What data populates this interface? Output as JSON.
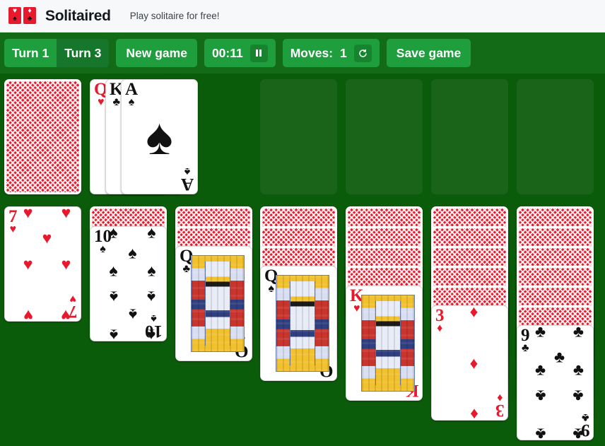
{
  "header": {
    "brand": "Solitaired",
    "tagline": "Play solitaire for free!",
    "logo_icon": "two-playing-cards-icon",
    "logo_card_1_top": "♥",
    "logo_card_1_bottom": "♠",
    "logo_card_2_top": "♦",
    "logo_card_2_bottom": "♣"
  },
  "toolbar": {
    "turn1_label": "Turn 1",
    "turn3_label": "Turn 3",
    "active_turn_mode": "Turn 1",
    "new_game_label": "New game",
    "timer_value": "00:11",
    "pause_icon": "pause-icon",
    "moves_label": "Moves:",
    "moves_count": "1",
    "restart_icon": "undo-restart-icon",
    "save_game_label": "Save game",
    "bar_color": "#136b18",
    "button_color": "#1f9e3e",
    "button_inactive_color": "#16772c"
  },
  "board": {
    "felt_color": "#0a5c0a",
    "slot_color": "#1a641a",
    "card_back_color": "#e8192c",
    "stock": {
      "name": "stock-pile",
      "face_down_count": 1
    },
    "waste": {
      "name": "waste-pile",
      "cards": [
        {
          "rank": "Q",
          "suit": "♥",
          "color": "red",
          "type": "court"
        },
        {
          "rank": "K",
          "suit": "♣",
          "color": "black",
          "type": "court"
        },
        {
          "rank": "A",
          "suit": "♠",
          "color": "black",
          "type": "ace"
        }
      ]
    },
    "foundations": [
      {
        "name": "foundation-spades",
        "empty": true
      },
      {
        "name": "foundation-hearts",
        "empty": true
      },
      {
        "name": "foundation-clubs",
        "empty": true
      },
      {
        "name": "foundation-diamonds",
        "empty": true
      }
    ],
    "tableau": [
      {
        "name": "tableau-column-1",
        "face_down": 0,
        "face_up": {
          "rank": "7",
          "suit": "♥",
          "color": "red",
          "type": "pip",
          "pips": 7
        }
      },
      {
        "name": "tableau-column-2",
        "face_down": 1,
        "face_up": {
          "rank": "10",
          "suit": "♠",
          "color": "black",
          "type": "pip",
          "pips": 10
        }
      },
      {
        "name": "tableau-column-3",
        "face_down": 2,
        "face_up": {
          "rank": "Q",
          "suit": "♣",
          "color": "black",
          "type": "court"
        }
      },
      {
        "name": "tableau-column-4",
        "face_down": 3,
        "face_up": {
          "rank": "Q",
          "suit": "♠",
          "color": "black",
          "type": "court"
        }
      },
      {
        "name": "tableau-column-5",
        "face_down": 4,
        "face_up": {
          "rank": "K",
          "suit": "♥",
          "color": "red",
          "type": "court"
        }
      },
      {
        "name": "tableau-column-6",
        "face_down": 5,
        "face_up": {
          "rank": "3",
          "suit": "♦",
          "color": "red",
          "type": "pip",
          "pips": 3
        }
      },
      {
        "name": "tableau-column-7",
        "face_down": 6,
        "face_up": {
          "rank": "9",
          "suit": "♣",
          "color": "black",
          "type": "pip",
          "pips": 9
        }
      }
    ]
  }
}
